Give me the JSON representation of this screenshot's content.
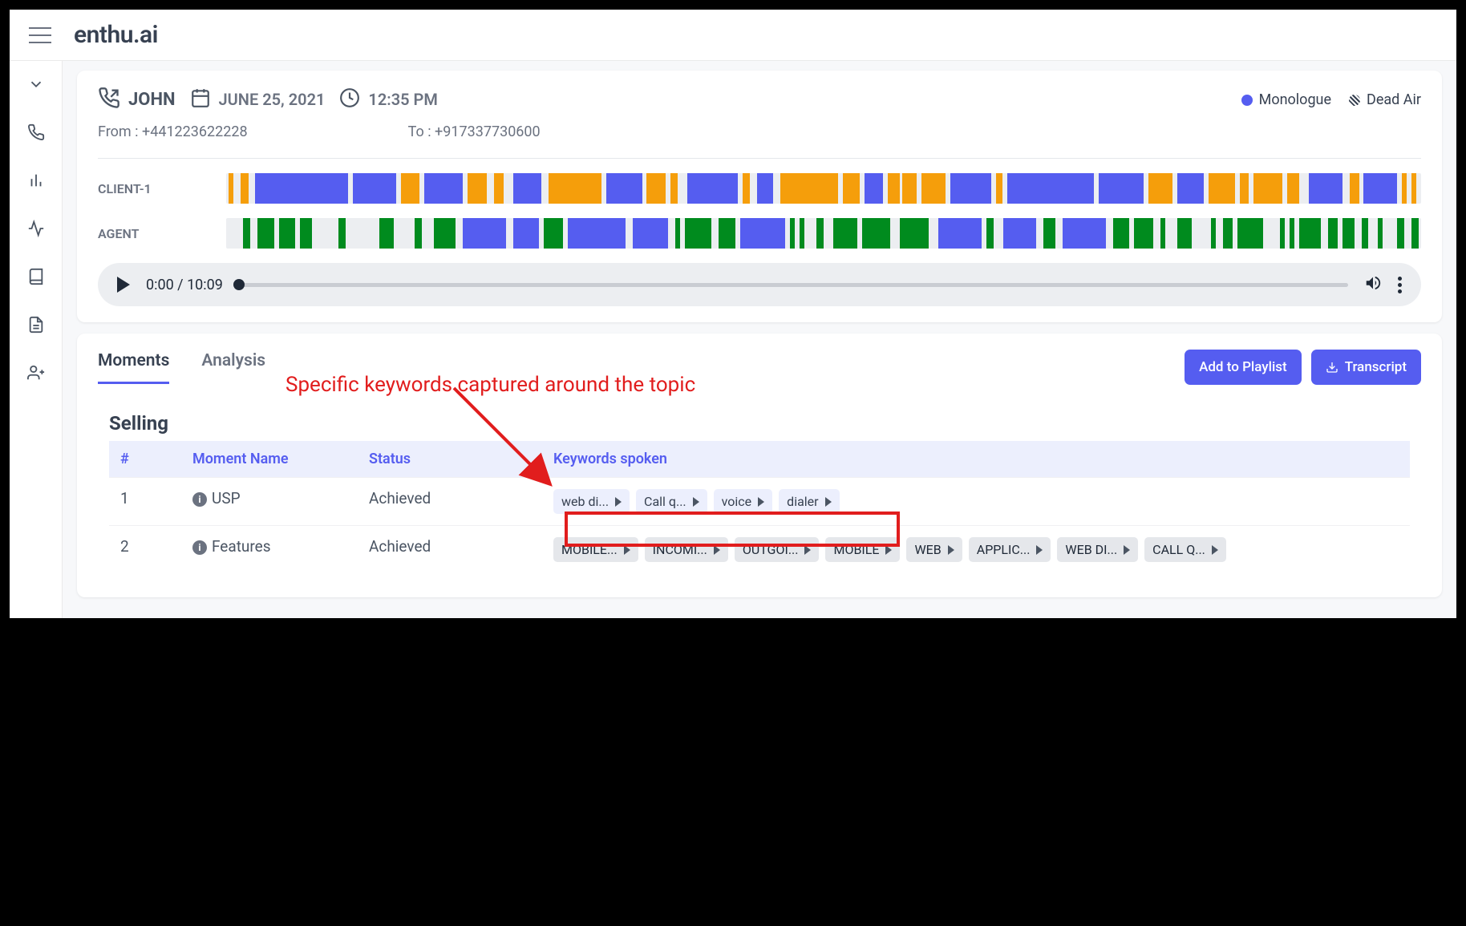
{
  "header": {
    "logo": "enthu.ai"
  },
  "call": {
    "name": "JOHN",
    "date": "JUNE 25, 2021",
    "time": "12:35 PM",
    "from_label": "From :",
    "from_value": "+441223622228",
    "to_label": "To :",
    "to_value": "+917337730600",
    "legend_monologue": "Monologue",
    "legend_deadair": "Dead Air",
    "track1_label": "CLIENT-1",
    "track2_label": "AGENT",
    "time_display": "0:00 / 10:09"
  },
  "tabs": {
    "moments": "Moments",
    "analysis": "Analysis"
  },
  "buttons": {
    "playlist": "Add to Playlist",
    "transcript": "Transcript"
  },
  "annotation_text": "Specific keywords captured around the topic",
  "moments": {
    "section_title": "Selling",
    "headers": {
      "num": "#",
      "name": "Moment Name",
      "status": "Status",
      "keywords": "Keywords spoken"
    },
    "rows": [
      {
        "num": "1",
        "name": "USP",
        "status": "Achieved",
        "keywords": [
          {
            "label": "web di...",
            "light": true
          },
          {
            "label": "Call q...",
            "light": true
          },
          {
            "label": "voice",
            "light": true
          },
          {
            "label": "dialer",
            "light": true
          }
        ]
      },
      {
        "num": "2",
        "name": "Features",
        "status": "Achieved",
        "keywords": [
          {
            "label": "MOBILE..."
          },
          {
            "label": "INCOMI..."
          },
          {
            "label": "OUTGOI..."
          },
          {
            "label": "MOBILE"
          },
          {
            "label": "WEB"
          },
          {
            "label": "APPLIC..."
          },
          {
            "label": "WEB DI..."
          },
          {
            "label": "CALL Q..."
          }
        ]
      }
    ]
  },
  "track1_segments": [
    {
      "c": "orange",
      "l": 0.2,
      "w": 0.4
    },
    {
      "c": "orange",
      "l": 1.2,
      "w": 0.7
    },
    {
      "c": "blue",
      "l": 2.4,
      "w": 7.8
    },
    {
      "c": "blue",
      "l": 10.6,
      "w": 3.6
    },
    {
      "c": "orange",
      "l": 14.6,
      "w": 1.6
    },
    {
      "c": "blue",
      "l": 16.6,
      "w": 3.2
    },
    {
      "c": "orange",
      "l": 20.2,
      "w": 1.6
    },
    {
      "c": "orange",
      "l": 22.4,
      "w": 0.8
    },
    {
      "c": "blue",
      "l": 24.0,
      "w": 2.4
    },
    {
      "c": "orange",
      "l": 27.0,
      "w": 4.4
    },
    {
      "c": "blue",
      "l": 31.8,
      "w": 3.0
    },
    {
      "c": "orange",
      "l": 35.2,
      "w": 1.6
    },
    {
      "c": "orange",
      "l": 37.2,
      "w": 0.6
    },
    {
      "c": "blue",
      "l": 38.6,
      "w": 4.2
    },
    {
      "c": "orange",
      "l": 43.2,
      "w": 0.6
    },
    {
      "c": "blue",
      "l": 44.4,
      "w": 1.4
    },
    {
      "c": "orange",
      "l": 46.4,
      "w": 4.8
    },
    {
      "c": "orange",
      "l": 51.6,
      "w": 1.4
    },
    {
      "c": "blue",
      "l": 53.4,
      "w": 1.6
    },
    {
      "c": "orange",
      "l": 55.4,
      "w": 1.0
    },
    {
      "c": "orange",
      "l": 56.6,
      "w": 1.2
    },
    {
      "c": "orange",
      "l": 58.2,
      "w": 2.0
    },
    {
      "c": "blue",
      "l": 60.6,
      "w": 3.4
    },
    {
      "c": "orange",
      "l": 64.4,
      "w": 0.6
    },
    {
      "c": "blue",
      "l": 65.4,
      "w": 7.2
    },
    {
      "c": "blue",
      "l": 73.0,
      "w": 3.8
    },
    {
      "c": "orange",
      "l": 77.2,
      "w": 2.0
    },
    {
      "c": "blue",
      "l": 79.6,
      "w": 2.2
    },
    {
      "c": "orange",
      "l": 82.2,
      "w": 2.2
    },
    {
      "c": "orange",
      "l": 84.8,
      "w": 0.8
    },
    {
      "c": "orange",
      "l": 86.0,
      "w": 2.4
    },
    {
      "c": "orange",
      "l": 88.8,
      "w": 1.0
    },
    {
      "c": "blue",
      "l": 90.6,
      "w": 2.8
    },
    {
      "c": "orange",
      "l": 94.0,
      "w": 0.8
    },
    {
      "c": "blue",
      "l": 95.2,
      "w": 2.8
    },
    {
      "c": "orange",
      "l": 98.4,
      "w": 0.4
    },
    {
      "c": "orange",
      "l": 99.2,
      "w": 0.4
    }
  ],
  "track2_segments": [
    {
      "c": "green",
      "l": 1.4,
      "w": 0.6
    },
    {
      "c": "green",
      "l": 2.6,
      "w": 1.4
    },
    {
      "c": "green",
      "l": 4.4,
      "w": 1.4
    },
    {
      "c": "green",
      "l": 6.2,
      "w": 1.0
    },
    {
      "c": "green",
      "l": 9.4,
      "w": 0.6
    },
    {
      "c": "green",
      "l": 12.8,
      "w": 1.2
    },
    {
      "c": "green",
      "l": 15.8,
      "w": 0.6
    },
    {
      "c": "green",
      "l": 17.4,
      "w": 1.8
    },
    {
      "c": "blue",
      "l": 19.8,
      "w": 3.6
    },
    {
      "c": "blue",
      "l": 24.0,
      "w": 2.2
    },
    {
      "c": "green",
      "l": 26.6,
      "w": 1.6
    },
    {
      "c": "blue",
      "l": 28.6,
      "w": 4.8
    },
    {
      "c": "blue",
      "l": 34.0,
      "w": 3.0
    },
    {
      "c": "green",
      "l": 37.6,
      "w": 0.4
    },
    {
      "c": "green",
      "l": 38.4,
      "w": 2.2
    },
    {
      "c": "green",
      "l": 41.2,
      "w": 1.4
    },
    {
      "c": "blue",
      "l": 43.0,
      "w": 3.8
    },
    {
      "c": "green",
      "l": 47.2,
      "w": 0.4
    },
    {
      "c": "green",
      "l": 48.0,
      "w": 0.4
    },
    {
      "c": "green",
      "l": 49.4,
      "w": 0.6
    },
    {
      "c": "green",
      "l": 50.8,
      "w": 2.0
    },
    {
      "c": "green",
      "l": 53.2,
      "w": 2.4
    },
    {
      "c": "green",
      "l": 56.4,
      "w": 2.4
    },
    {
      "c": "blue",
      "l": 59.6,
      "w": 3.6
    },
    {
      "c": "green",
      "l": 63.6,
      "w": 0.6
    },
    {
      "c": "blue",
      "l": 65.0,
      "w": 2.8
    },
    {
      "c": "green",
      "l": 68.4,
      "w": 1.0
    },
    {
      "c": "blue",
      "l": 70.0,
      "w": 3.6
    },
    {
      "c": "green",
      "l": 74.2,
      "w": 1.4
    },
    {
      "c": "green",
      "l": 76.0,
      "w": 1.6
    },
    {
      "c": "green",
      "l": 78.2,
      "w": 0.4
    },
    {
      "c": "green",
      "l": 79.6,
      "w": 1.2
    },
    {
      "c": "green",
      "l": 82.4,
      "w": 0.4
    },
    {
      "c": "green",
      "l": 83.4,
      "w": 0.8
    },
    {
      "c": "green",
      "l": 84.6,
      "w": 2.2
    },
    {
      "c": "green",
      "l": 88.2,
      "w": 0.4
    },
    {
      "c": "green",
      "l": 89.0,
      "w": 0.4
    },
    {
      "c": "green",
      "l": 89.8,
      "w": 1.8
    },
    {
      "c": "green",
      "l": 92.2,
      "w": 0.8
    },
    {
      "c": "green",
      "l": 93.4,
      "w": 1.0
    },
    {
      "c": "green",
      "l": 95.0,
      "w": 0.6
    },
    {
      "c": "green",
      "l": 96.4,
      "w": 0.4
    },
    {
      "c": "green",
      "l": 98.0,
      "w": 0.6
    },
    {
      "c": "green",
      "l": 99.2,
      "w": 0.6
    }
  ]
}
